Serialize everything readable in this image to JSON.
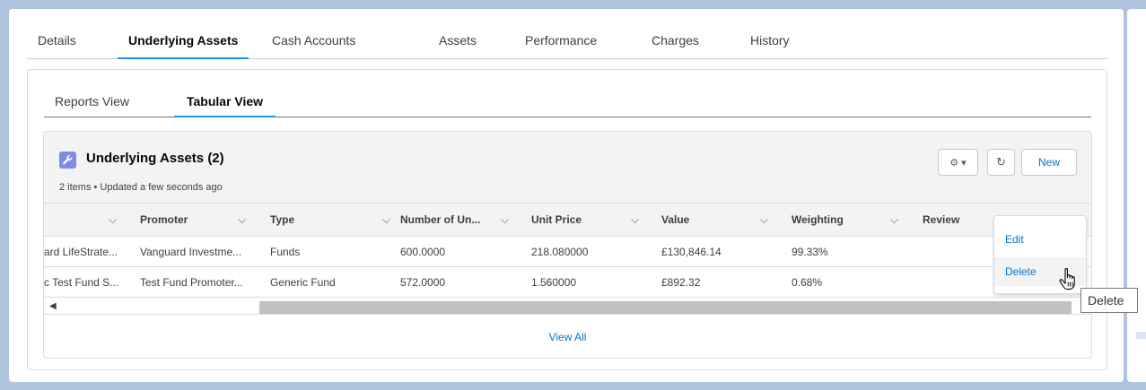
{
  "top_tabs": [
    {
      "label": "Details"
    },
    {
      "label": "Underlying Assets",
      "active": true
    },
    {
      "label": "Cash Accounts"
    },
    {
      "label": "Assets"
    },
    {
      "label": "Performance"
    },
    {
      "label": "Charges"
    },
    {
      "label": "History"
    }
  ],
  "sub_tabs": [
    {
      "label": "Reports View"
    },
    {
      "label": "Tabular View",
      "active": true
    }
  ],
  "related_list": {
    "icon": "wrench-icon",
    "title": "Underlying Assets (2)",
    "subtitle": "2 items • Updated a few seconds ago",
    "gear_label": "⚙ ▾",
    "refresh_label": "↻",
    "new_label": "New",
    "view_all": "View All"
  },
  "table": {
    "columns": [
      "",
      "Promoter",
      "Type",
      "Number of Un...",
      "Unit Price",
      "Value",
      "Weighting",
      "Review"
    ],
    "rows": [
      [
        "ard LifeStrate...",
        "Vanguard Investme...",
        "Funds",
        "600.0000",
        "218.080000",
        "£130,846.14",
        "99.33%",
        ""
      ],
      [
        "c Test Fund S...",
        "Test Fund Promoter...",
        "Generic Fund",
        "572.0000",
        "1.560000",
        "£892.32",
        "0.68%",
        ""
      ]
    ]
  },
  "row_menu": {
    "items": [
      "Edit",
      "Delete"
    ]
  },
  "tooltip": "Delete",
  "colors": {
    "accent": "#1b96ff",
    "link": "#0176d3",
    "icon_bg": "#7f8de1",
    "page_bg": "#b0c4df"
  }
}
